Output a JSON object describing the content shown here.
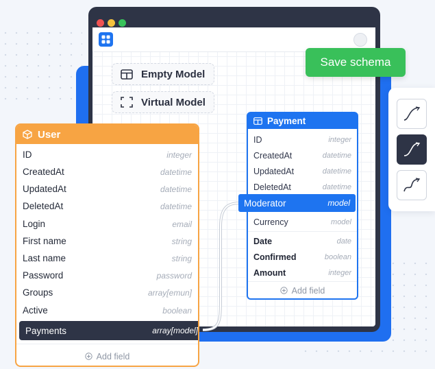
{
  "canvas": {
    "empty_model_label": "Empty Model",
    "virtual_model_label": "Virtual Model",
    "save_label": "Save schema"
  },
  "connector_styles": [
    {
      "name": "curve-style-1",
      "active": false
    },
    {
      "name": "curve-style-2",
      "active": true
    },
    {
      "name": "curve-style-3",
      "active": false
    }
  ],
  "user_model": {
    "title": "User",
    "fields": [
      {
        "name": "ID",
        "type": "integer"
      },
      {
        "name": "CreatedAt",
        "type": "datetime"
      },
      {
        "name": "UpdatedAt",
        "type": "datetime"
      },
      {
        "name": "DeletedAt",
        "type": "datetime"
      },
      {
        "name": "Login",
        "type": "email"
      },
      {
        "name": "First name",
        "type": "string"
      },
      {
        "name": "Last name",
        "type": "string"
      },
      {
        "name": "Password",
        "type": "password"
      },
      {
        "name": "Groups",
        "type": "array[emun]"
      },
      {
        "name": "Active",
        "type": "boolean"
      },
      {
        "name": "Payments",
        "type": "array[model]"
      }
    ],
    "add_field_label": "Add field"
  },
  "payment_model": {
    "title": "Payment",
    "fields": [
      {
        "name": "ID",
        "type": "integer"
      },
      {
        "name": "CreatedAt",
        "type": "datetime"
      },
      {
        "name": "UpdatedAt",
        "type": "datetime"
      },
      {
        "name": "DeletedAt",
        "type": "datetime"
      },
      {
        "name": "Moderator",
        "type": "model"
      },
      {
        "name": "Currency",
        "type": "model"
      },
      {
        "name": "Date",
        "type": "date"
      },
      {
        "name": "Confirmed",
        "type": "boolean"
      },
      {
        "name": "Amount",
        "type": "integer"
      }
    ],
    "add_field_label": "Add field"
  },
  "colors": {
    "user_accent": "#f7a443",
    "payment_accent": "#1e74f0",
    "save_green": "#39c05a",
    "dark": "#2e3446"
  }
}
